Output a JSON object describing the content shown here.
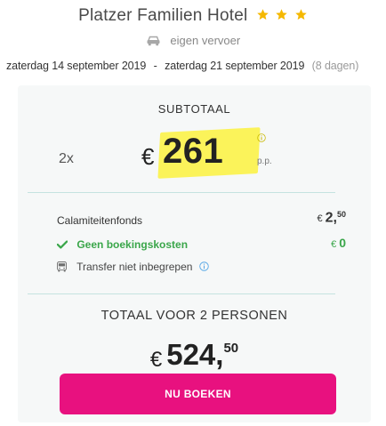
{
  "hotel": {
    "name": "Platzer Familien Hotel",
    "stars": 3,
    "star_color": "#f5b800"
  },
  "transport": {
    "icon": "car-icon",
    "label": "eigen vervoer"
  },
  "dates": {
    "start": "zaterdag 14 september 2019",
    "separator": "-",
    "end": "zaterdag 21 september 2019",
    "nights": "(8 dagen)"
  },
  "subtotal": {
    "label": "SUBTOTAAL",
    "count": "2x",
    "currency": "€",
    "price": "261",
    "per_person": "p.p.",
    "highlight_color": "#fbf35a"
  },
  "fees": {
    "calamity_label": "Calamiteitenfonds",
    "calamity_currency": "€",
    "calamity_whole": "2,",
    "calamity_cents": "50",
    "booking_label": "Geen boekingskosten",
    "booking_currency": "€",
    "booking_value": "0",
    "transfer_label": "Transfer niet inbegrepen"
  },
  "total": {
    "label": "TOTAAL VOOR 2 PERSONEN",
    "currency": "€",
    "whole": "524,",
    "cents": "50"
  },
  "cta": {
    "label": "NU BOEKEN",
    "color": "#e8117f"
  },
  "colors": {
    "positive": "#3aa64a",
    "divider": "#c5e3e0",
    "info": "#5aa9e6",
    "panel_bg": "#f6f8f8"
  }
}
